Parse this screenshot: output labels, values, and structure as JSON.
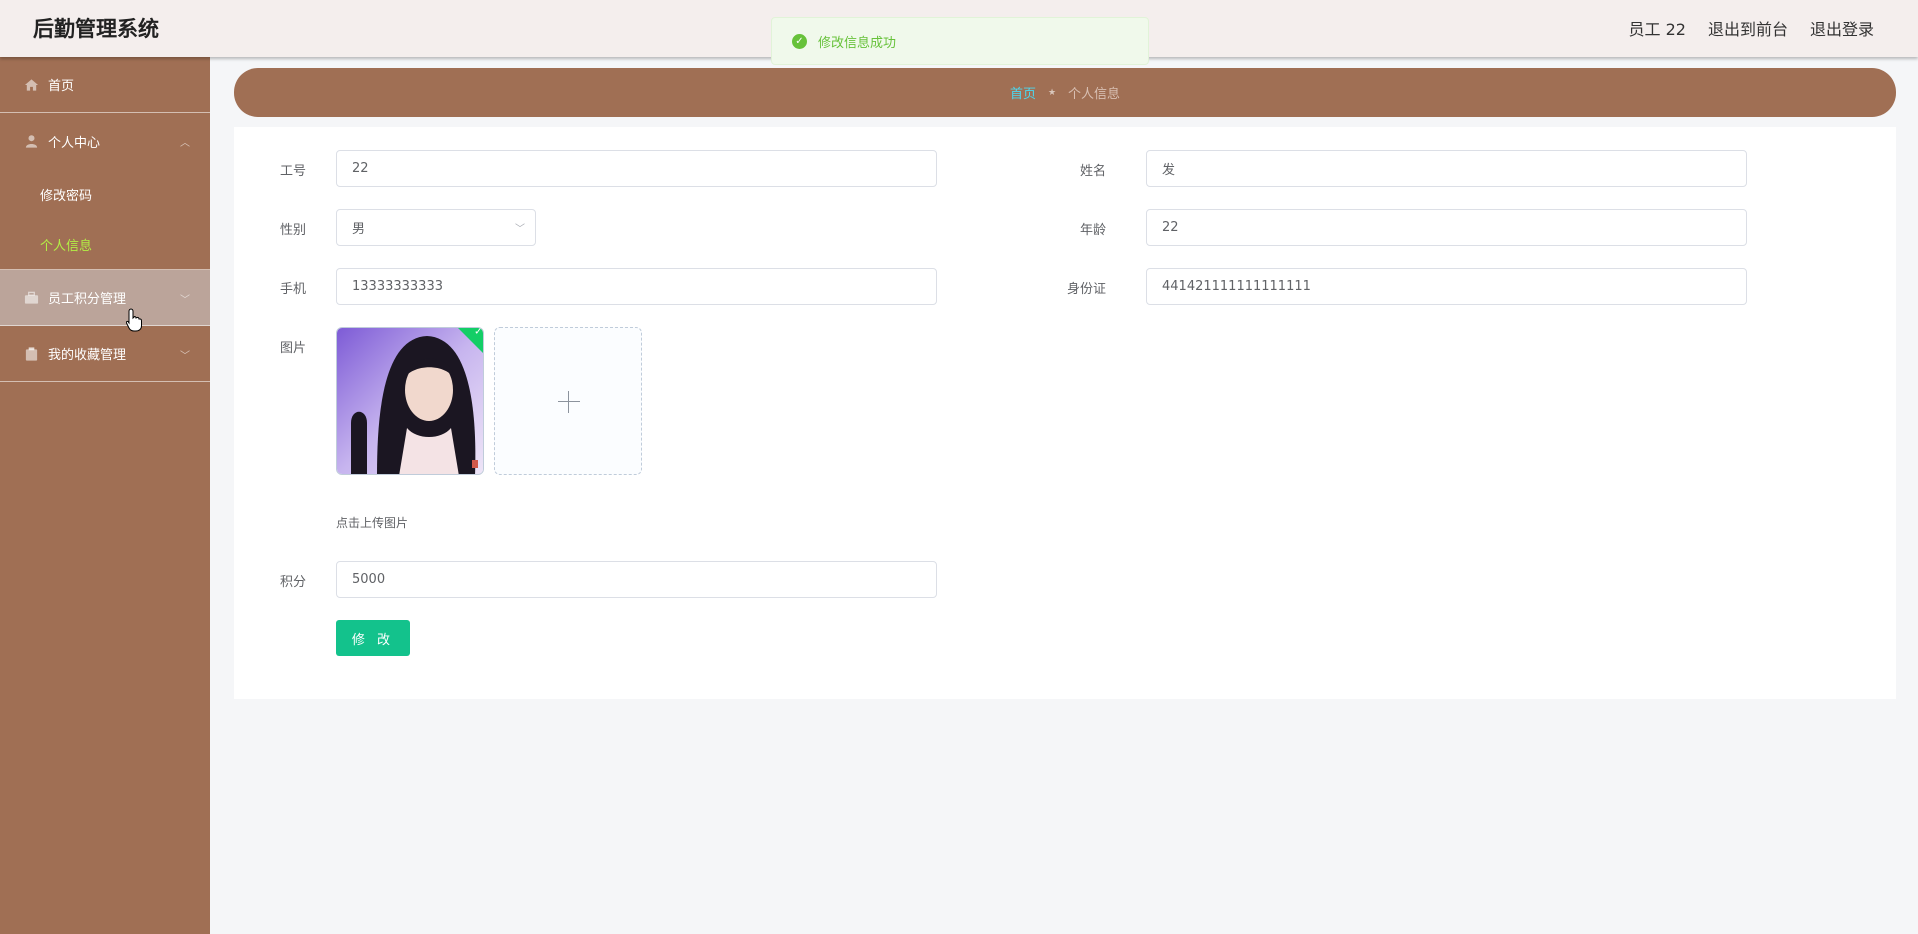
{
  "header": {
    "app_title": "后勤管理系统",
    "user_label": "员工 22",
    "back_to_front": "退出到前台",
    "logout": "退出登录"
  },
  "toast": {
    "message": "修改信息成功",
    "icon": "success-check-icon",
    "color": "#67c23a"
  },
  "sidebar": {
    "home": "首页",
    "personal_center": "个人中心",
    "change_password": "修改密码",
    "personal_info": "个人信息",
    "points_mgmt": "员工积分管理",
    "favorites_mgmt": "我的收藏管理"
  },
  "breadcrumb": {
    "home": "首页",
    "current": "个人信息"
  },
  "form": {
    "employee_no": {
      "label": "工号",
      "value": "22"
    },
    "name": {
      "label": "姓名",
      "value": "发"
    },
    "gender": {
      "label": "性别",
      "value": "男"
    },
    "age": {
      "label": "年龄",
      "value": "22"
    },
    "phone": {
      "label": "手机",
      "value": "13333333333"
    },
    "id_card": {
      "label": "身份证",
      "value": "441421111111111111"
    },
    "photo": {
      "label": "图片",
      "hint": "点击上传图片"
    },
    "points": {
      "label": "积分",
      "value": "5000"
    },
    "submit": "修 改"
  },
  "colors": {
    "sidebar": "#a06f54",
    "accent_active": "#b3ee45",
    "button": "#13c28c",
    "breadcrumb_home": "#4bd8f0"
  }
}
